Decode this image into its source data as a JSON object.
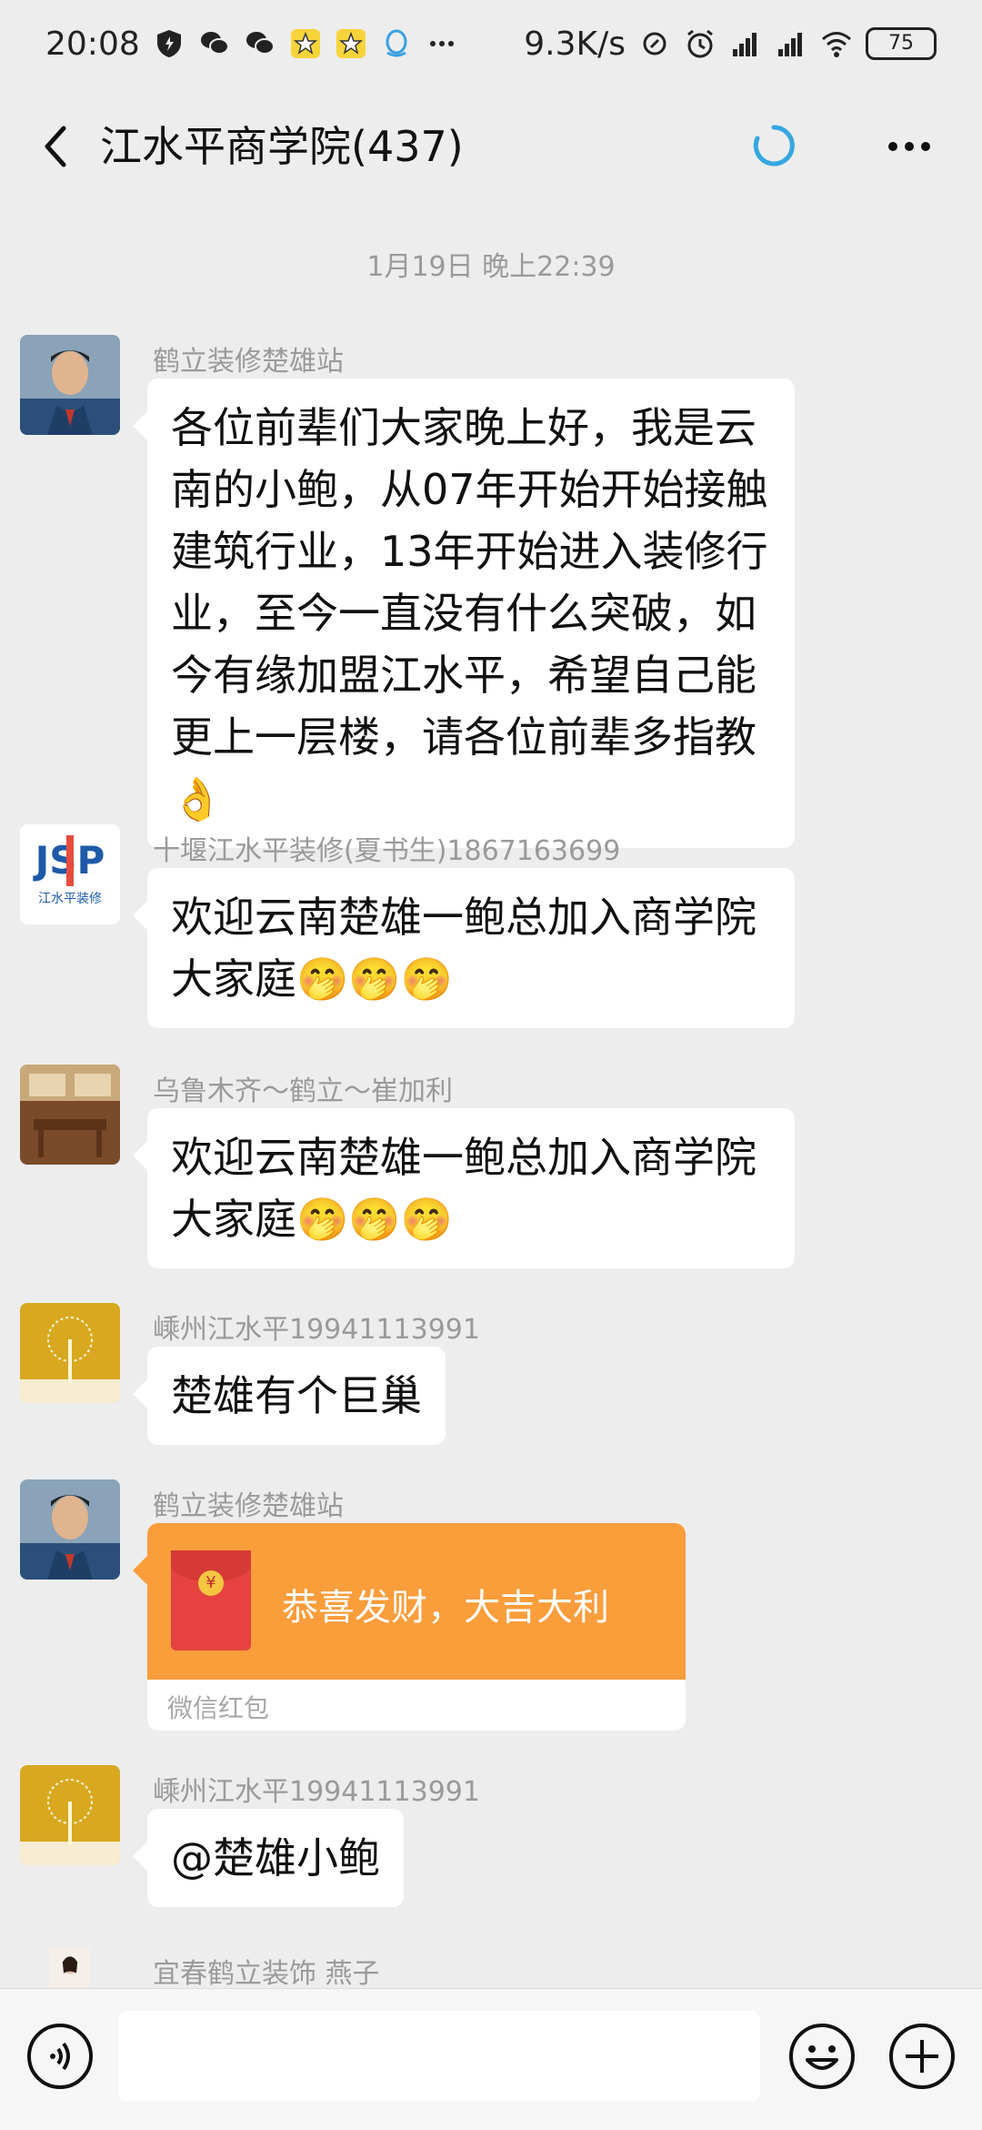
{
  "status_bar": {
    "time": "20:08",
    "network_speed": "9.3K/s",
    "battery": "75",
    "icons": [
      "shield-icon",
      "wechat-icon",
      "wechat-icon",
      "star-icon",
      "star-icon",
      "qq-icon",
      "more-dots-icon",
      "link-icon",
      "alarm-icon",
      "hd-signal-icon",
      "signal-icon",
      "wifi-icon",
      "battery-icon"
    ]
  },
  "header": {
    "title": "江水平商学院(437)"
  },
  "timestamp": "1月19日 晚上22:39",
  "messages": [
    {
      "sender": "鹤立装修楚雄站",
      "text": "各位前辈们大家晚上好，我是云南的小鲍，从07年开始开始接触建筑行业，13年开始进入装修行业，至今一直没有什么突破，如今有缘加盟江水平，希望自己能更上一层楼，请各位前辈多指教👌"
    },
    {
      "sender": "十堰江水平装修(夏书生)1867163699",
      "text": "欢迎云南楚雄一鲍总加入商学院大家庭🤭🤭🤭",
      "avatar_text": "江水平装修"
    },
    {
      "sender": "乌鲁木齐～鹤立～崔加利",
      "text": "欢迎云南楚雄一鲍总加入商学院大家庭🤭🤭🤭"
    },
    {
      "sender": "嵊州江水平19941113991",
      "text": "楚雄有个巨巢"
    },
    {
      "sender": "鹤立装修楚雄站",
      "red_packet": {
        "title": "恭喜发财，大吉大利",
        "footer": "微信红包"
      }
    },
    {
      "sender": "嵊州江水平19941113991",
      "text": "@楚雄小鲍"
    },
    {
      "sender": "宜春鹤立装饰  燕子"
    }
  ],
  "input_bar": {
    "placeholder": ""
  },
  "colors": {
    "background": "#ededed",
    "bubble": "#ffffff",
    "red_packet": "#fa9d3b",
    "sync_icon": "#35a7e0"
  }
}
